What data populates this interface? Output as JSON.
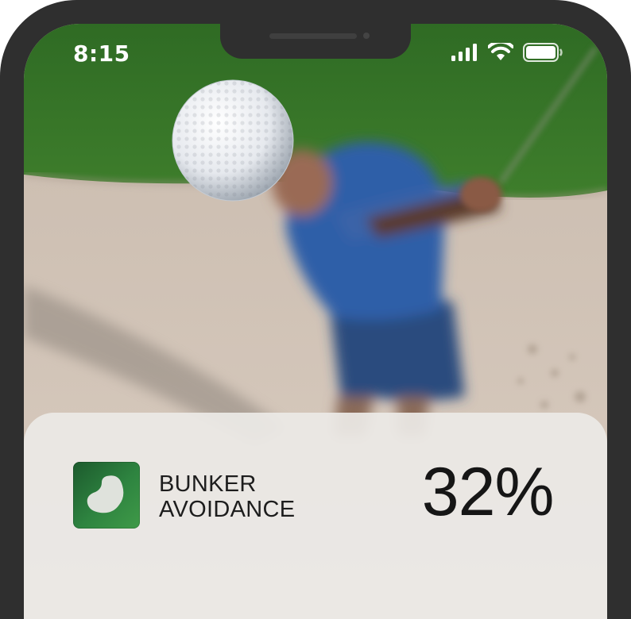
{
  "status_bar": {
    "time": "8:15",
    "icons": [
      "cellular-signal-icon",
      "wifi-icon",
      "battery-icon"
    ]
  },
  "hero": {
    "image": "golfer-bunker-shot-photo"
  },
  "stat_card": {
    "icon": "bunker-icon",
    "label_line1": "BUNKER",
    "label_line2": "AVOIDANCE",
    "value": "32%"
  },
  "colors": {
    "frame": "#2f2f2f",
    "icon_green": "#2e8440",
    "card": "#eceae6"
  }
}
